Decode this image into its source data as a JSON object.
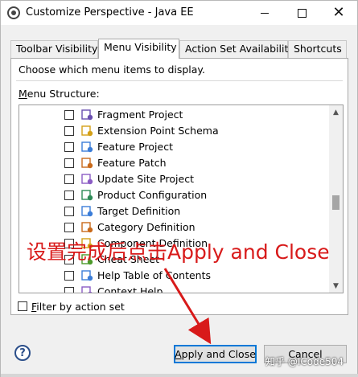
{
  "window": {
    "title": "Customize Perspective - Java EE",
    "min_label": "—",
    "max_label": "☐",
    "close_label": "✕"
  },
  "tabs": [
    {
      "label": "Toolbar Visibility",
      "active": false
    },
    {
      "label": "Menu Visibility",
      "active": true
    },
    {
      "label": "Action Set Availability",
      "active": false
    },
    {
      "label": "Shortcuts",
      "active": false
    }
  ],
  "panel": {
    "instruction": "Choose which menu items to display.",
    "menu_structure_accel": "M",
    "menu_structure_rest": "enu Structure:"
  },
  "tree_items": [
    {
      "label": "Fragment Project",
      "icon": "fragment-project-icon",
      "checked": false
    },
    {
      "label": "Extension Point Schema",
      "icon": "extension-point-schema-icon",
      "checked": false
    },
    {
      "label": "Feature Project",
      "icon": "feature-project-icon",
      "checked": false
    },
    {
      "label": "Feature Patch",
      "icon": "feature-patch-icon",
      "checked": false
    },
    {
      "label": "Update Site Project",
      "icon": "update-site-project-icon",
      "checked": false
    },
    {
      "label": "Product Configuration",
      "icon": "product-configuration-icon",
      "checked": false
    },
    {
      "label": "Target Definition",
      "icon": "target-definition-icon",
      "checked": false
    },
    {
      "label": "Category Definition",
      "icon": "category-definition-icon",
      "checked": false
    },
    {
      "label": "Component Definition",
      "icon": "component-definition-icon",
      "checked": false
    },
    {
      "label": "Cheat Sheet",
      "icon": "cheat-sheet-icon",
      "checked": false
    },
    {
      "label": "Help Table of Contents",
      "icon": "help-toc-icon",
      "checked": false
    },
    {
      "label": "Context Help",
      "icon": "context-help-icon",
      "checked": false
    }
  ],
  "scrollbar": {
    "up": "▲",
    "down": "▼"
  },
  "filter": {
    "accel": "F",
    "rest": "ilter by action set",
    "checked": false
  },
  "footer": {
    "help_label": "?",
    "apply_accel": "A",
    "apply_rest": "pply and Close",
    "cancel_label": "Cancel"
  },
  "annotation": {
    "text": "设置完成后点击Apply and Close",
    "color": "#d81a1a"
  },
  "watermark": "知乎 @ICode504",
  "colors": {
    "accent": "#0078d7",
    "annotation": "#d81a1a"
  }
}
